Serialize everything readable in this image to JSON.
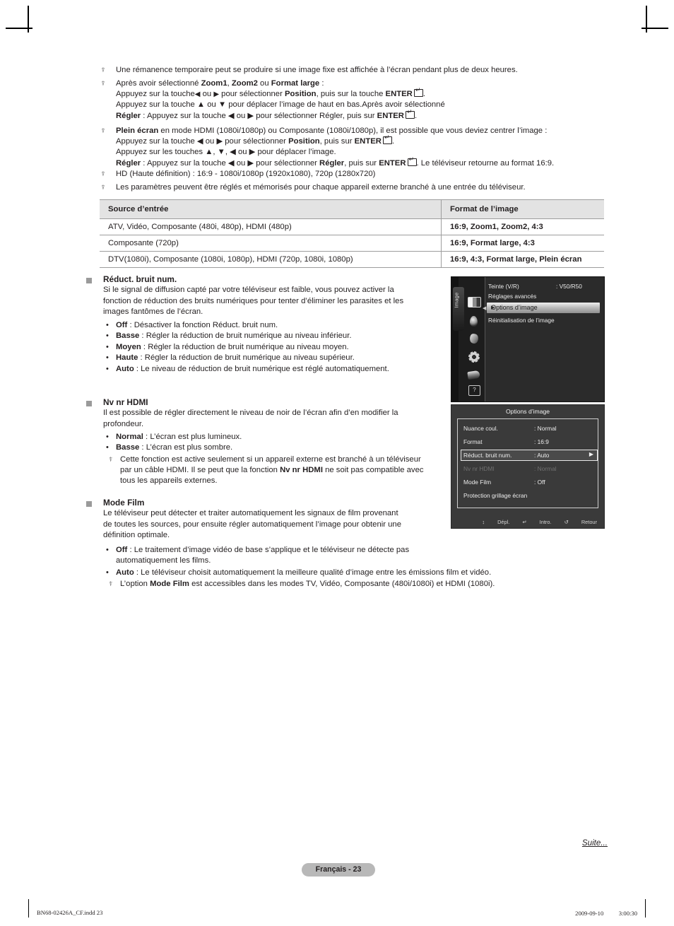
{
  "crop_marks": true,
  "notes_top": [
    {
      "icon": "note-icon",
      "lines": [
        "Une rémanence temporaire peut se produire si une image fixe est affichée à l’écran pendant plus de deux heures."
      ]
    }
  ],
  "note2": {
    "icon": "note-icon",
    "l1_a": "Après avoir sélectionné ",
    "l1_b1": "Zoom1",
    "l1_c": ", ",
    "l1_b2": "Zoom2",
    "l1_d": " ou ",
    "l1_b3": "Format large",
    "l1_e": " :",
    "l2_a": "Appuyez sur la touche",
    "l2_b": " ou ",
    "l2_c": " pour sélectionner ",
    "l2_d": "Position",
    "l2_e": ", puis sur la touche ",
    "l2_f": "ENTER",
    "l3": "Appuyez sur la touche ▲ ou ▼ pour déplacer l’image de haut en bas.Après avoir sélectionné",
    "l4_a": "Régler",
    "l4_b": " : Appuyez sur la touche ◀ ou ▶ pour sélectionner Régler, puis sur ",
    "l4_c": "ENTER"
  },
  "note3": {
    "icon": "note-icon",
    "l1_a": "Plein écran",
    "l1_b": " en mode HDMI (1080i/1080p) ou Composante (1080i/1080p), il est possible que vous deviez centrer l’image :",
    "l2_a": "Appuyez sur la touche ◀ ou ▶ pour sélectionner ",
    "l2_b": "Position",
    "l2_c": ", puis sur ",
    "l2_d": "ENTER",
    "l3": "Appuyez sur les touches ▲, ▼, ◀ ou ▶ pour déplacer l’image.",
    "l4_a": "Régler",
    "l4_b": " : Appuyez sur la touche ◀ ou ▶ pour sélectionner ",
    "l4_c": "Régler",
    "l4_d": ", puis sur ",
    "l4_e": "ENTER",
    "l4_f": ". Le téléviseur retourne au format 16:9."
  },
  "note4": {
    "icon": "note-icon",
    "text": "HD (Haute définition) : 16:9 - 1080i/1080p (1920x1080), 720p (1280x720)"
  },
  "note5": {
    "icon": "note-icon",
    "text": "Les paramètres peuvent être réglés et mémorisés pour chaque appareil externe branché à une entrée du téléviseur."
  },
  "table": {
    "headers": [
      "Source d’entrée",
      "Format de l’image"
    ],
    "rows": [
      [
        "ATV, Vidéo, Composante (480i, 480p), HDMI (480p)",
        "16:9, Zoom1, Zoom2, 4:3"
      ],
      [
        "Composante (720p)",
        "16:9, Format large, 4:3"
      ],
      [
        "DTV(1080i), Composante (1080i, 1080p), HDMI (720p, 1080i, 1080p)",
        "16:9, 4:3, Format large, Plein écran"
      ]
    ]
  },
  "section_dnr": {
    "title": "Réduct. bruit num.",
    "body_l1": "Si le signal de diffusion capté par votre téléviseur est faible, vous pouvez activer la",
    "body_l2": "fonction de réduction des bruits numériques pour tenter d’éliminer les parasites et les",
    "body_l3": "images fantômes de l’écran.",
    "items": [
      {
        "term": "Off",
        "desc": " : Désactiver la fonction Réduct. bruit num."
      },
      {
        "term": "Basse",
        "desc": " : Régler la réduction de bruit numérique au niveau inférieur."
      },
      {
        "term": "Moyen",
        "desc": " : Régler la réduction de bruit numérique au niveau moyen."
      },
      {
        "term": "Haute",
        "desc": " : Régler la réduction de bruit numérique au niveau supérieur."
      },
      {
        "term": "Auto",
        "desc": " : Le niveau de réduction de bruit numérique est réglé automatiquement."
      }
    ]
  },
  "section_hdmi": {
    "title": "Nv nr HDMI",
    "body_l1": "Il est possible de régler directement le niveau de noir de l’écran afin d’en modifier la",
    "body_l2": "profondeur.",
    "items": [
      {
        "term": "Normal",
        "desc": " : L’écran est plus lumineux."
      },
      {
        "term": "Basse",
        "desc": " : L’écran est plus sombre."
      }
    ],
    "note_l1": "Cette fonction est active seulement si un appareil externe est branché à un téléviseur",
    "note_l2_a": "par un câble HDMI. Il se peut que la fonction ",
    "note_l2_b": "Nv nr HDMI",
    "note_l2_c": " ne soit pas compatible avec",
    "note_l3": "tous les appareils externes."
  },
  "section_film": {
    "title": "Mode Film",
    "body_l1": "Le téléviseur peut détecter et traiter automatiquement les signaux de film provenant",
    "body_l2": "de toutes les sources, pour ensuite régler automatiquement l’image pour obtenir une",
    "body_l3": "définition optimale.",
    "item1_term": "Off",
    "item1_l1": " : Le traitement d’image vidéo de base s’applique et le téléviseur ne détecte pas",
    "item1_l2": "automatiquement les films.",
    "item2_term": "Auto",
    "item2_desc": " : Le téléviseur choisit automatiquement la meilleure qualité d’image entre les émissions film et vidéo.",
    "note_a": "L’option ",
    "note_b": "Mode Film",
    "note_c": " est accessibles dans les modes TV, Vidéo, Composante (480i/1080i) et HDMI (1080i)."
  },
  "osd_picture_menu": {
    "rail_label": "Image",
    "icons": [
      "picture-icon",
      "sound-icon",
      "channel-icon",
      "setup-icon",
      "input-icon",
      "support-icon"
    ],
    "rows": [
      {
        "label": "Teinte (V/R)",
        "value": ": V50/R50"
      },
      {
        "label": "Réglages avancés",
        "value": ""
      },
      {
        "label": "Réinitialisation de l’image",
        "value": ""
      }
    ],
    "selected": {
      "label": "Options d’image",
      "chevron": "▶"
    }
  },
  "osd_picture_options": {
    "title": "Options d’image",
    "rows": [
      {
        "label": "Nuance coul.",
        "value": ": Normal",
        "state": "normal"
      },
      {
        "label": "Format",
        "value": ": 16:9",
        "state": "normal"
      },
      {
        "label": "Réduct. bruit num.",
        "value": ": Auto",
        "state": "selected"
      },
      {
        "label": "Nv nr HDMI",
        "value": ": Normal",
        "state": "disabled"
      },
      {
        "label": "Mode Film",
        "value": ": Off",
        "state": "normal"
      },
      {
        "label": "Protection grillage écran",
        "value": "",
        "state": "normal"
      }
    ],
    "footer": [
      {
        "icon": "updown-icon",
        "label": "Dépl."
      },
      {
        "icon": "enter-icon",
        "label": "Intro."
      },
      {
        "icon": "return-icon",
        "label": "Retour"
      }
    ]
  },
  "footer": {
    "continued": "Suite...",
    "page_badge": "Français - 23",
    "print_left": "BN68-02426A_CF.indd   23",
    "print_right": "2009-09-10   　　 3:00:30"
  },
  "colors": {
    "table_header_bg": "#e3e3e3",
    "bullet_square": "#9a9a9a",
    "badge_bg": "#b8b8b8",
    "osd_bg": "#2c2c2c",
    "osd_panel_bg": "#3a3a3a"
  }
}
